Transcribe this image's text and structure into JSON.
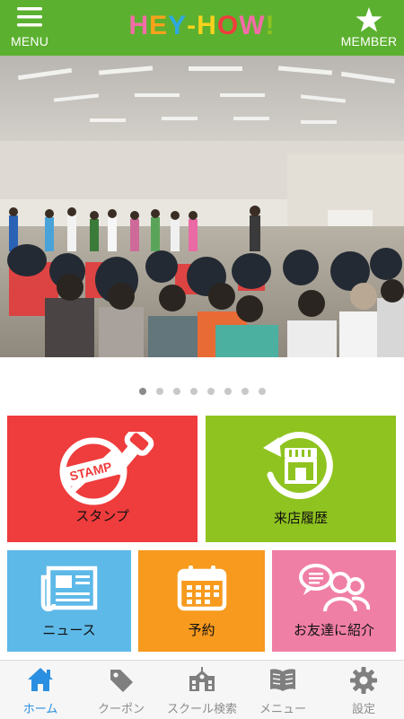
{
  "header": {
    "title": "HEY-HOW!",
    "title_letters": [
      "H",
      "E",
      "Y",
      "-",
      "H",
      "O",
      "W",
      "!"
    ],
    "title_colors": [
      "#f36ca6",
      "#f7a21c",
      "#2ea8e3",
      "#f7d21c",
      "#f7d21c",
      "#f03c3c",
      "#f36ca6",
      "#8fc31f"
    ],
    "menu_label": "MENU",
    "member_label": "MEMBER",
    "bg_color": "#5cb030"
  },
  "carousel": {
    "image": "event-photo",
    "page_count": 8,
    "active_index": 0
  },
  "tiles": {
    "stamp": {
      "label": "スタンプ",
      "icon_text": "STAMP",
      "color": "#ef3c3c"
    },
    "visit_history": {
      "label": "来店履歴",
      "color": "#8fc31f"
    },
    "news": {
      "label": "ニュース",
      "color": "#5db9e8"
    },
    "reservation": {
      "label": "予約",
      "color": "#f79a1e"
    },
    "invite_friend": {
      "label": "お友達に紹介",
      "color": "#f07fa5"
    }
  },
  "tabbar": {
    "active_color": "#2a8fe0",
    "items": [
      {
        "label": "ホーム",
        "icon": "home-icon",
        "active": true
      },
      {
        "label": "クーポン",
        "icon": "tag-icon",
        "active": false
      },
      {
        "label": "スクール検索",
        "icon": "school-icon",
        "active": false
      },
      {
        "label": "メニュー",
        "icon": "book-icon",
        "active": false
      },
      {
        "label": "設定",
        "icon": "gear-icon",
        "active": false
      }
    ]
  }
}
